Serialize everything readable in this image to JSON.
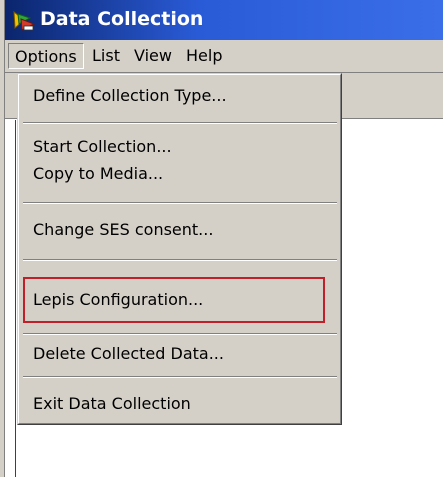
{
  "window": {
    "title": "Data Collection",
    "icon": "app-icon"
  },
  "menubar": {
    "items": [
      {
        "label": "Options",
        "active": true
      },
      {
        "label": "List",
        "active": false
      },
      {
        "label": "View",
        "active": false
      },
      {
        "label": "Help",
        "active": false
      }
    ]
  },
  "options_menu": {
    "items": [
      {
        "label": "Define Collection Type..."
      },
      {
        "label": "Start Collection..."
      },
      {
        "label": "Copy to Media..."
      },
      {
        "label": "Change SES consent..."
      },
      {
        "label": "Lepis Configuration..."
      },
      {
        "label": "Delete Collected Data..."
      },
      {
        "label": "Exit Data Collection"
      }
    ],
    "highlight_color": "#c0202a"
  },
  "colors": {
    "titlebar_start": "#0a246a",
    "titlebar_end": "#3a6ee8",
    "chrome": "#d4d0c8"
  }
}
